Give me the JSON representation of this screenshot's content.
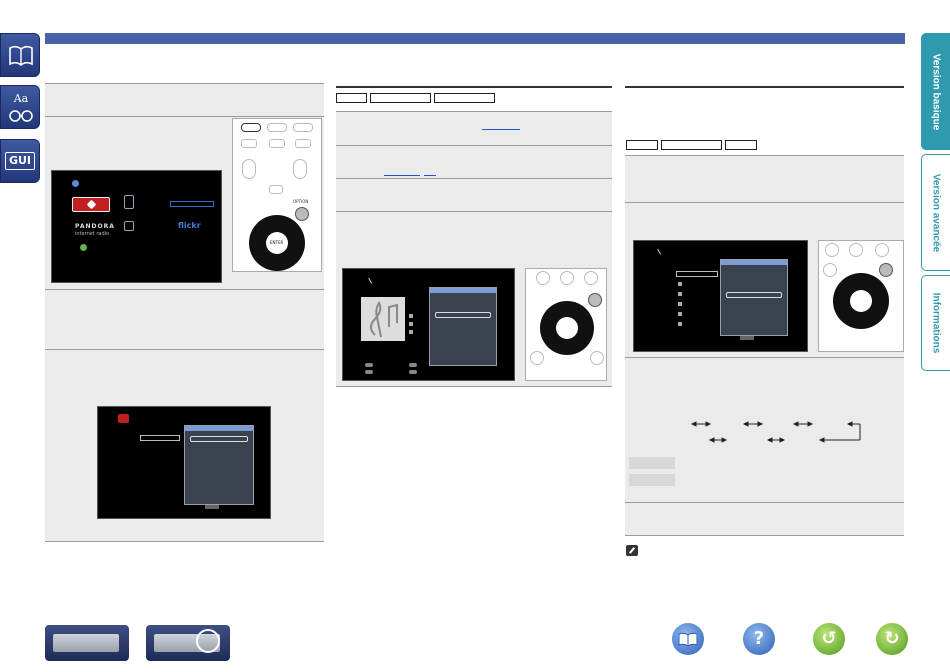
{
  "side_tabs": [
    {
      "label": "Version basique",
      "active": true
    },
    {
      "label": "Version avancée",
      "active": false
    },
    {
      "label": "Informations",
      "active": false
    }
  ],
  "left_icons": [
    {
      "icon": "book-icon"
    },
    {
      "icon": "glossary-icon",
      "text": "Aa"
    },
    {
      "icon": "gui-icon",
      "text": "GUI"
    }
  ],
  "tv1": {
    "services": [
      "PANDORA",
      "internet radio",
      "flickr"
    ]
  },
  "remote": {
    "option_label": "OPTION",
    "enter_label": "ENTER"
  },
  "colors": {
    "accent_blue": "#4a63a6",
    "tab_teal": "#2f9aae",
    "panel_grey": "#ebebeb"
  },
  "bottom_icons": [
    "book-icon",
    "help-icon",
    "back-icon",
    "forward-icon"
  ],
  "bottom_icon_text": {
    "help": "?"
  }
}
